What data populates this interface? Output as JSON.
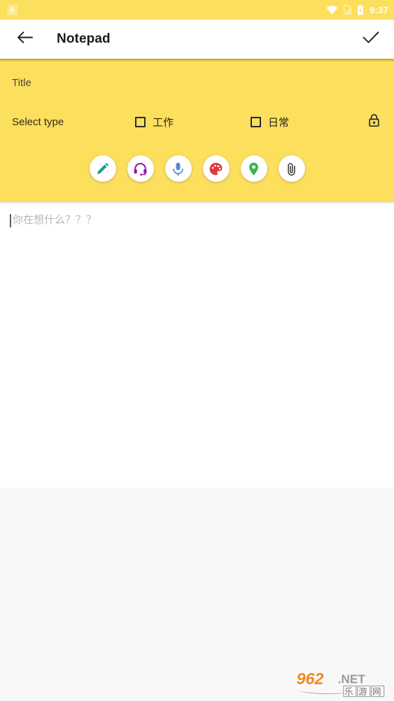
{
  "statusbar": {
    "notification_icon": "app-notification-icon",
    "notification_letter": "A",
    "wifi_icon": "wifi-icon",
    "sim_icon": "sim-card-icon",
    "battery_icon": "battery-charging-icon",
    "time": "9:37"
  },
  "toolbar": {
    "back_icon": "back-arrow-icon",
    "title": "Notepad",
    "done_icon": "checkmark-icon"
  },
  "form": {
    "title_placeholder": "Title",
    "title_value": "",
    "select_type_label": "Select type",
    "types": [
      {
        "label": "工作",
        "checked": false
      },
      {
        "label": "日常",
        "checked": false
      }
    ],
    "lock_icon": "lock-icon"
  },
  "actions": [
    {
      "name": "pencil-icon",
      "label": "Handwriting",
      "color": "#1a9e8f"
    },
    {
      "name": "headphones-icon",
      "label": "Audio",
      "color": "#8e1ca5"
    },
    {
      "name": "microphone-icon",
      "label": "Record",
      "color": "#4a89dc"
    },
    {
      "name": "palette-icon",
      "label": "Draw",
      "color": "#e03a3a"
    },
    {
      "name": "location-pin-icon",
      "label": "Location",
      "color": "#36b84c"
    },
    {
      "name": "paperclip-icon",
      "label": "Attachment",
      "color": "#3c3c3c"
    }
  ],
  "note": {
    "placeholder": "你在想什么？？？",
    "value": ""
  },
  "watermark": {
    "number": "962",
    "tld": ".NET",
    "cn": "乐游网"
  },
  "colors": {
    "accent_yellow": "#fddf5e",
    "toolbar_bg": "#ffffff",
    "bottom_fill": "#f8f8f8",
    "text_dark": "#1b1b1b",
    "placeholder": "#b6b6b6"
  }
}
